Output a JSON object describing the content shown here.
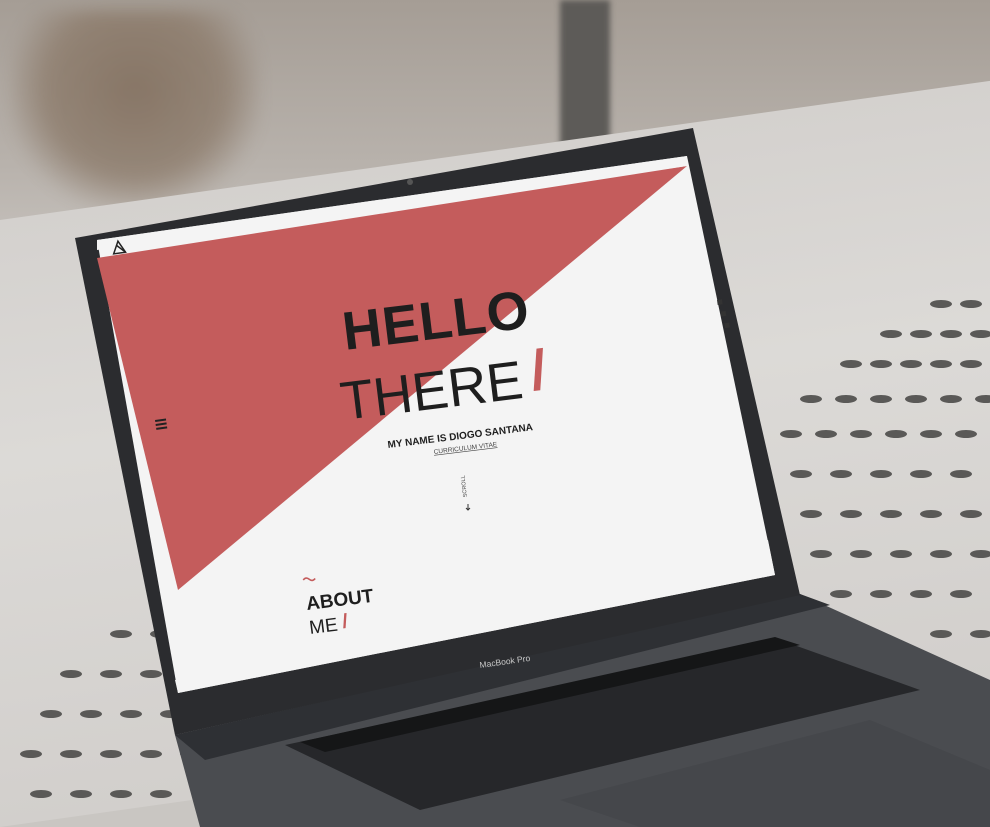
{
  "hero": {
    "title_line1": "HELLO",
    "title_line2": "THERE",
    "slash": "/",
    "subtitle": "MY NAME IS DIOGO SANTANA",
    "cv_link": "CURRICULUM VITAE",
    "scroll_label": "SCROLL"
  },
  "about": {
    "title_line1": "ABOUT",
    "title_line2": "ME",
    "slash": "/"
  },
  "device": {
    "brand": "MacBook Pro"
  },
  "colors": {
    "accent": "#c45c5c",
    "page_bg": "#f4f4f4",
    "text": "#1e1e1e",
    "laptop_body": "#3c3e42"
  },
  "icons": [
    "logo-icon",
    "menu-icon",
    "linkedin-icon",
    "behance-icon",
    "mail-icon",
    "arrow-down-icon"
  ]
}
